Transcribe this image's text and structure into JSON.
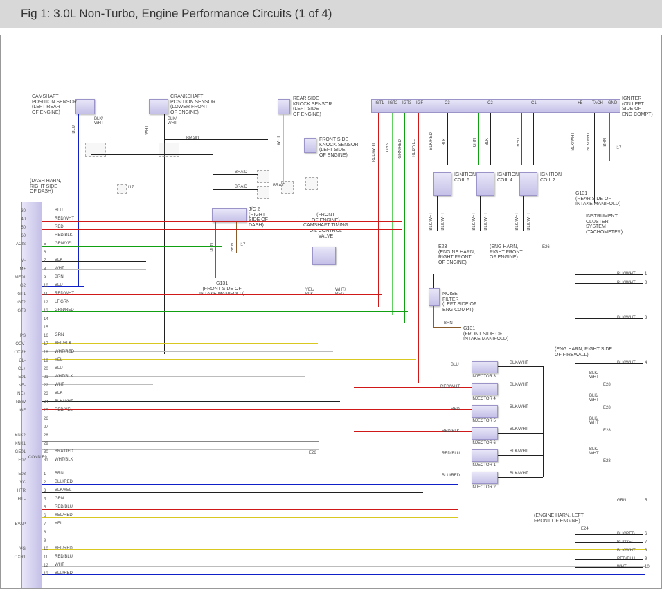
{
  "header": {
    "title": "Fig 1: 3.0L Non-Turbo, Engine Performance Circuits (1 of 4)"
  },
  "components": {
    "camshaft_pos_sensor": {
      "name": "CAMSHAFT\nPOSITION SENSOR\n(LEFT REAR\nOF ENGINE)"
    },
    "crankshaft_pos_sensor": {
      "name": "CRANKSHAFT\nPOSITION SENSOR\n(LOWER FRONT\nOF ENGINE)"
    },
    "rear_knock": {
      "name": "REAR SIDE\nKNOCK SENSOR\n(LEFT SIDE\nOF ENGINE)"
    },
    "front_knock": {
      "name": "FRONT SIDE\nKNOCK SENSOR\n(LEFT SIDE\nOF ENGINE)"
    },
    "igniter": {
      "name": "IGNITER\n(ON LEFT\nSIDE OF\nENG COMPT)"
    },
    "jc2": {
      "name": "J/C 2\n(RIGHT\nSIDE OF\nDASH)"
    },
    "cam_timing_valve": {
      "name": "(FRONT\nOF ENGINE)\nCAMSHAFT TIMING\nOIL CONTROL\nVALVE"
    },
    "ign_coil_6": {
      "name": "IGNITION\nCOIL 6"
    },
    "ign_coil_4": {
      "name": "IGNITION\nCOIL 4"
    },
    "ign_coil_2": {
      "name": "IGNITION\nCOIL 2"
    },
    "noise_filter": {
      "name": "NOISE\nFILTER\n(LEFT SIDE OF\nENG COMPT)"
    },
    "injector1": {
      "name": "INJECTOR 1"
    },
    "injector2": {
      "name": "INJECTOR 2"
    },
    "injector3": {
      "name": "INJECTOR 3"
    },
    "injector4": {
      "name": "INJECTOR 4"
    },
    "injector5": {
      "name": "INJECTOR 5"
    },
    "injector6": {
      "name": "INJECTOR 6"
    }
  },
  "notes": {
    "dash_harn": "(DASH HARN,\nRIGHT SIDE\nOF DASH)",
    "g131_rear": "G131\n(REAR SIDE OF\nINTAKE MANIFOLD)",
    "g131_front_1": "G131\n(FRONT SIDE OF\nINTAKE MANIFOLD)",
    "g131_front_2": "G131\n(FRONT SIDE OF\nINTAKE MANIFOLD)",
    "cluster": "INSTRUMENT\nCLUSTER\nSYSTEM\n(TACHOMETER)",
    "e23": "E23\n(ENGINE HARN,\nRIGHT FRONT\nOF ENGINE)",
    "eng_harn_e26": "(ENG HARN,\nRIGHT FRONT\nOF ENGINE)",
    "eng_harn_firewall": "(ENG HARN, RIGHT SIDE\nOF FIREWALL)",
    "eng_harn_left": "(ENGINE HARN, LEFT\nFRONT OF ENGINE)",
    "i17a": "I17",
    "i17b": "I17",
    "i17c": "I17",
    "e26a": "E26",
    "e26b": "E26",
    "e28a": "E28",
    "e28b": "E28",
    "e28c": "E28",
    "e28d": "E28",
    "e24": "E24",
    "conn_e9": "CONN E9"
  },
  "igniter_pins": [
    "IGT1",
    "IGT2",
    "IGT3",
    "IGF",
    "C3-",
    "C2-",
    "C1-",
    "+B",
    "TACH",
    "GND"
  ],
  "igniter_wires": [
    "RED/WHT",
    "LT GRN",
    "GRN/RED",
    "RED/YEL",
    "BLK/RED",
    "BLK",
    "GRN",
    "BLK",
    "RED",
    "BLK/WHT",
    "BLK/WHT",
    "BRN"
  ],
  "ecu_pins": [
    {
      "n": "30",
      "sig": "",
      "col": "BLU"
    },
    {
      "n": "40",
      "sig": "",
      "col": "RED/WHT"
    },
    {
      "n": "50",
      "sig": "",
      "col": "RED"
    },
    {
      "n": "60",
      "sig": "",
      "col": "RED/BLK"
    },
    {
      "n": "ACIS",
      "sig": "5",
      "col": "GRN/YEL"
    },
    {
      "n": "",
      "sig": "6",
      "col": ""
    },
    {
      "n": "M-",
      "sig": "7",
      "col": "BLK"
    },
    {
      "n": "M+",
      "sig": "8",
      "col": "WHT"
    },
    {
      "n": "ME01",
      "sig": "9",
      "col": "BRN"
    },
    {
      "n": "G2",
      "sig": "10",
      "col": "BLU"
    },
    {
      "n": "IGT1",
      "sig": "11",
      "col": "RED/WHT"
    },
    {
      "n": "IGT2",
      "sig": "12",
      "col": "LT GRN"
    },
    {
      "n": "IGT3",
      "sig": "13",
      "col": "GRN/RED"
    },
    {
      "n": "",
      "sig": "14",
      "col": ""
    },
    {
      "n": "",
      "sig": "15",
      "col": ""
    },
    {
      "n": "PS",
      "sig": "16",
      "col": "GRN"
    },
    {
      "n": "OCV-",
      "sig": "17",
      "col": "YEL/BLK"
    },
    {
      "n": "OCV+",
      "sig": "18",
      "col": "WHT/RED"
    },
    {
      "n": "CL-",
      "sig": "19",
      "col": "YEL"
    },
    {
      "n": "CL+",
      "sig": "20",
      "col": "BLU"
    },
    {
      "n": "E01",
      "sig": "21",
      "col": "WHT/BLK"
    },
    {
      "n": "NE-",
      "sig": "22",
      "col": "WHT"
    },
    {
      "n": "NE+",
      "sig": "23",
      "col": "BLK"
    },
    {
      "n": "NSW",
      "sig": "24",
      "col": "BLK/WHT"
    },
    {
      "n": "IGF",
      "sig": "25",
      "col": "RED/YEL"
    },
    {
      "n": "",
      "sig": "26",
      "col": ""
    },
    {
      "n": "",
      "sig": "27",
      "col": ""
    },
    {
      "n": "KNK2",
      "sig": "28",
      "col": ""
    },
    {
      "n": "KNK1",
      "sig": "29",
      "col": ""
    },
    {
      "n": "GE01",
      "sig": "30",
      "col": "BRAIDED"
    },
    {
      "n": "E02",
      "sig": "31",
      "col": "WHT/BLK"
    },
    {
      "n": "",
      "sig": "",
      "col": ""
    },
    {
      "n": "E03",
      "sig": "1",
      "col": "BRN"
    },
    {
      "n": "VC",
      "sig": "2",
      "col": "BLU/RED"
    },
    {
      "n": "HTR",
      "sig": "3",
      "col": "BLK/YEL"
    },
    {
      "n": "HTL",
      "sig": "4",
      "col": "GRN"
    },
    {
      "n": "",
      "sig": "5",
      "col": "RED/BLU"
    },
    {
      "n": "",
      "sig": "6",
      "col": "YEL/RED"
    },
    {
      "n": "EVAP",
      "sig": "7",
      "col": "YEL"
    },
    {
      "n": "",
      "sig": "8",
      "col": ""
    },
    {
      "n": "",
      "sig": "9",
      "col": ""
    },
    {
      "n": "VG",
      "sig": "10",
      "col": "YEL/RED"
    },
    {
      "n": "OXR1",
      "sig": "11",
      "col": "RED/BLU"
    },
    {
      "n": "",
      "sig": "12",
      "col": "WHT"
    },
    {
      "n": "",
      "sig": "13",
      "col": "BLU/RED"
    }
  ],
  "right_out_pins": [
    {
      "n": "1",
      "col": "BLK/WHT"
    },
    {
      "n": "2",
      "col": "BLK/WHT"
    },
    {
      "n": "3",
      "col": "BLK/WHT"
    },
    {
      "n": "4",
      "col": "BLK/WHT"
    },
    {
      "n": "5",
      "col": "GRN"
    },
    {
      "n": "6",
      "col": "BLK/RED"
    },
    {
      "n": "7",
      "col": "BLK/YEL"
    },
    {
      "n": "8",
      "col": "BLK/WHT"
    },
    {
      "n": "9",
      "col": "RED/BLU"
    },
    {
      "n": "10",
      "col": "WHT"
    }
  ],
  "injector_wires": {
    "in": [
      "BLU",
      "RED/WHT",
      "RED",
      "RED/BLK",
      "RED/BLU",
      "BLU/RED"
    ],
    "out": "BLK/WHT",
    "out2": "BLK/\nWHT"
  },
  "misc_wires": {
    "blu": "BLU",
    "blk_wht": "BLK/\nWHT",
    "wht": "WHT",
    "braid": "BRAID",
    "brn": "BRN",
    "brn_a": "BRN",
    "yel_blk": "YEL/\nBLK",
    "wht_red": "WHT/\nRED",
    "blk_wht_h": "BLK/WHT"
  }
}
